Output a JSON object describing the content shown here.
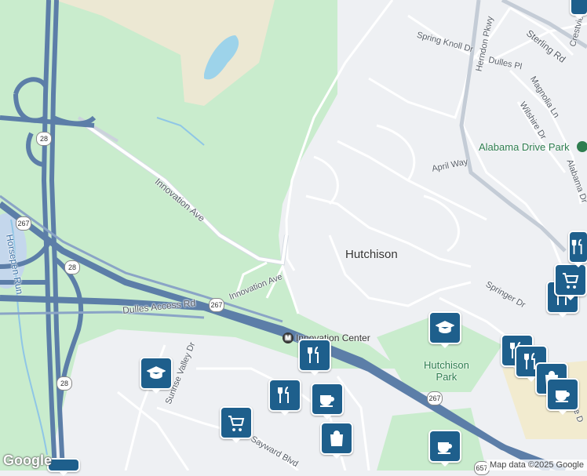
{
  "map": {
    "colors": {
      "land": "#eef0f3",
      "park": "#c9eccd",
      "open_land": "#ece8d3",
      "water": "#9dd3ea",
      "highway": "#5c7ea8",
      "road": "#ffffff",
      "poi_pin": "#1e5f8c"
    },
    "place_label": "Hutchison",
    "parks": {
      "alabama": "Alabama Drive Park",
      "hutchison": "Hutchison\nPark"
    },
    "roads": {
      "spring_knoll": "Spring Knoll Dr",
      "herndon_pkwy": "Herndon Pkwy",
      "sterling": "Sterling Rd",
      "crestview": "Crestview",
      "dulles_pl": "Dulles Pl",
      "magnolia": "Magnolia Ln",
      "wilshire": "Wilshire Dr",
      "april_way": "April Way",
      "alabama_dr": "Alabama Dr",
      "innovation_ave_1": "Innovation Ave",
      "innovation_ave_2": "Innovation Ave",
      "horsepen_run": "Horsepen Run",
      "dulles_access": "Dulles Access Rd",
      "sunrise_valley": "Sunrise Valley Dr",
      "springer": "Springer Dr",
      "sayward": "Sayward Blvd",
      "gate": "ate D"
    },
    "shields": {
      "r28_a": "28",
      "r28_b": "28",
      "r28_c": "28",
      "r267_a": "267",
      "r267_b": "267",
      "r267_c": "267",
      "r657": "657"
    },
    "metro_station": "Innovation Center",
    "pois": [
      {
        "icon": "restaurant-icon",
        "glyph": "🍴"
      },
      {
        "icon": "school-icon",
        "glyph": "🎓"
      },
      {
        "icon": "cafe-icon",
        "glyph": "☕"
      },
      {
        "icon": "shopping-bag-icon",
        "glyph": "🛍"
      },
      {
        "icon": "grocery-cart-icon",
        "glyph": "🛒"
      }
    ],
    "attribution": "Map data ©2025 Google",
    "logo": "Google"
  }
}
